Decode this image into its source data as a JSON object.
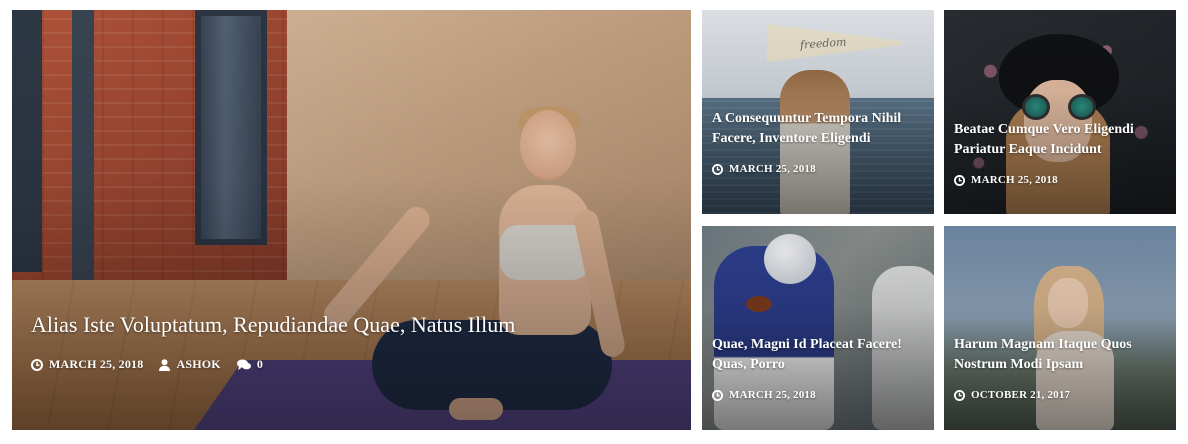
{
  "posts": [
    {
      "title": "Alias Iste Voluptatum, Repudiandae Quae, Natus Illum",
      "date": "MARCH 25, 2018",
      "author": "ASHOK",
      "comments": "0"
    },
    {
      "title": "A Consequuntur Tempora Nihil Facere, Inventore Eligendi",
      "date": "MARCH 25, 2018",
      "image_text": "freedom"
    },
    {
      "title": "Beatae Cumque Vero Eligendi Pariatur Eaque Incidunt",
      "date": "MARCH 25, 2018"
    },
    {
      "title": "Quae, Magni Id Placeat Facere! Quas, Porro",
      "date": "MARCH 25, 2018"
    },
    {
      "title": "Harum Magnam Itaque Quos Nostrum Modi Ipsam",
      "date": "OCTOBER 21, 2017"
    }
  ],
  "icons": {
    "date": "clock-icon",
    "author": "user-icon",
    "comments": "comments-icon"
  },
  "colors": {
    "text": "#ffffff",
    "background": "#ffffff"
  }
}
